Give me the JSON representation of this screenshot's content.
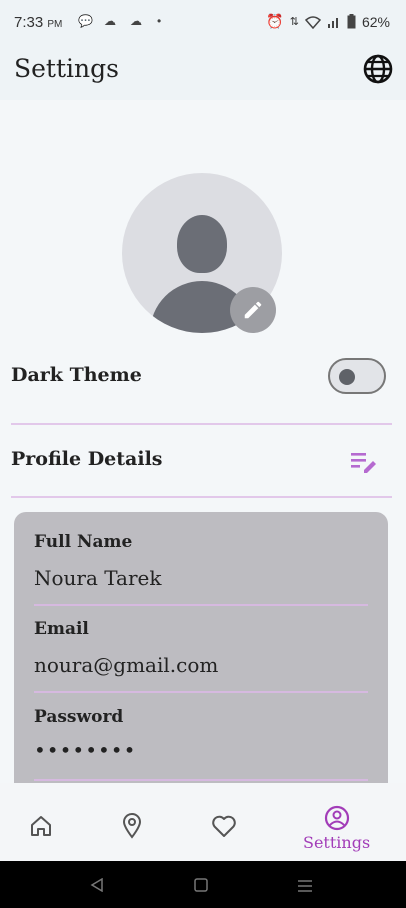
{
  "status_bar": {
    "time": "7:33",
    "ampm": "PM",
    "battery": "62%",
    "icons": [
      "chat-bubble-icon",
      "cloud-icon",
      "cloud-icon",
      "dot-icon",
      "alarm-icon",
      "data-arrows-icon",
      "wifi-icon",
      "signal-icon",
      "battery-icon"
    ]
  },
  "app_bar": {
    "title": "Settings",
    "language_icon": "globe-icon"
  },
  "profile": {
    "avatar_icon": "person-silhouette-icon",
    "edit_icon": "pencil-icon"
  },
  "settings": {
    "dark_theme_label": "Dark Theme",
    "dark_theme_on": false,
    "profile_details_label": "Profile Details",
    "profile_details_icon": "edit-list-icon"
  },
  "profile_card": {
    "full_name_label": "Full Name",
    "full_name_value": "Noura Tarek",
    "email_label": "Email",
    "email_value": "noura@gmail.com",
    "password_label": "Password",
    "password_value": "••••••••"
  },
  "bottom_nav": {
    "items": [
      {
        "icon": "home-icon",
        "label": ""
      },
      {
        "icon": "location-pin-icon",
        "label": ""
      },
      {
        "icon": "heart-icon",
        "label": ""
      },
      {
        "icon": "account-circle-icon",
        "label": "Settings",
        "active": true
      }
    ]
  },
  "colors": {
    "accent": "#a23cb8",
    "divider": "#e2c8ea",
    "card": "#bdbcc1"
  }
}
